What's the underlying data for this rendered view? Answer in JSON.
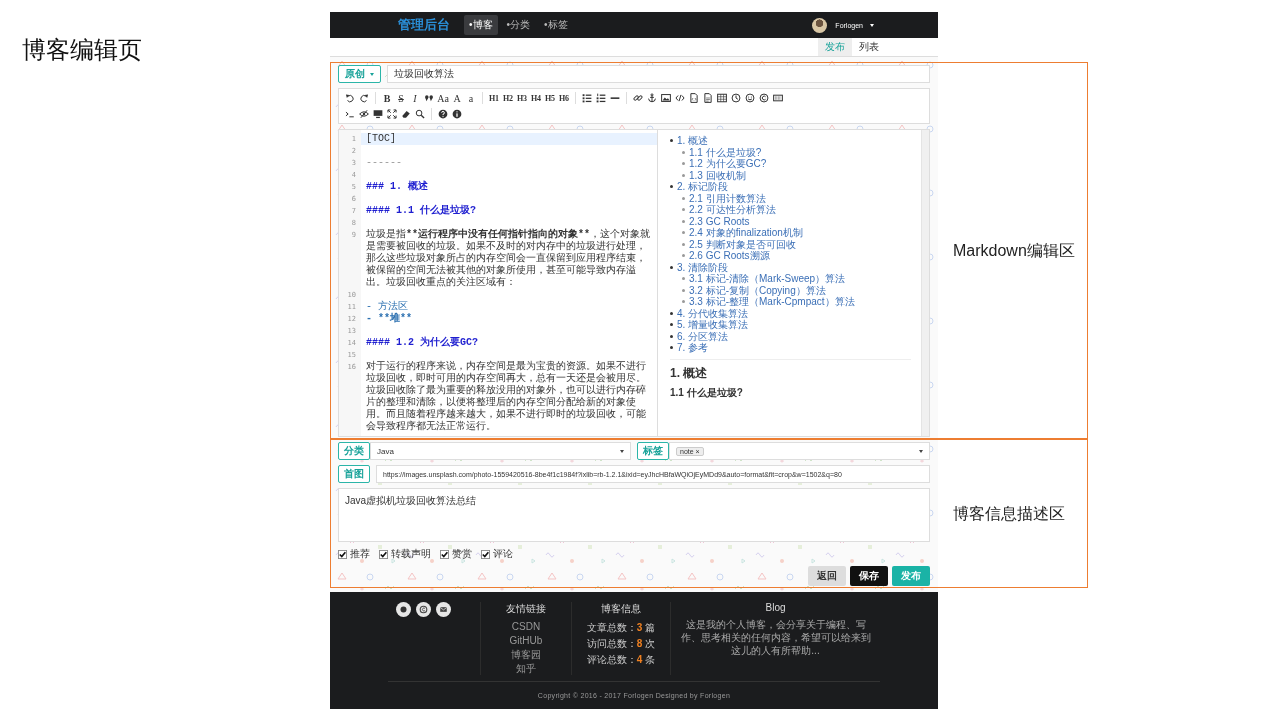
{
  "slide": {
    "title": "博客编辑页",
    "annotations": [
      {
        "label": "Markdown编辑区"
      },
      {
        "label": "博客信息描述区"
      }
    ]
  },
  "navbar": {
    "logo": "管理后台",
    "items": [
      {
        "label": "•博客",
        "selected": true
      },
      {
        "label": "•分类",
        "selected": false
      },
      {
        "label": "•标签",
        "selected": false
      }
    ],
    "user": "Forlogen"
  },
  "subnav": {
    "tabs": [
      {
        "label": "发布",
        "selected": true
      },
      {
        "label": "列表",
        "selected": false
      }
    ]
  },
  "editor": {
    "type_select": "原创",
    "title": "垃圾回收算法",
    "toolbar": [
      [
        [
          {
            "kind": "icon"
          },
          {
            "kind": "icon"
          }
        ],
        [
          {
            "kind": "bold",
            "text": "B"
          },
          {
            "kind": "strike",
            "text": "S"
          },
          {
            "kind": "italic",
            "text": "I"
          },
          {
            "kind": "icon"
          },
          {
            "kind": "text",
            "text": "Aa"
          },
          {
            "kind": "text",
            "text": "A"
          },
          {
            "kind": "text",
            "text": "a"
          }
        ],
        [
          {
            "kind": "heading",
            "text": "H1"
          },
          {
            "kind": "heading",
            "text": "H2"
          },
          {
            "kind": "heading",
            "text": "H3"
          },
          {
            "kind": "heading",
            "text": "H4"
          },
          {
            "kind": "heading",
            "text": "H5"
          },
          {
            "kind": "heading",
            "text": "H6"
          }
        ],
        [
          {
            "kind": "icon"
          },
          {
            "kind": "icon"
          },
          {
            "kind": "icon"
          }
        ],
        [
          {
            "kind": "icon"
          },
          {
            "kind": "icon"
          },
          {
            "kind": "icon"
          },
          {
            "kind": "icon"
          },
          {
            "kind": "icon"
          },
          {
            "kind": "icon"
          },
          {
            "kind": "icon"
          },
          {
            "kind": "icon"
          },
          {
            "kind": "icon"
          },
          {
            "kind": "icon"
          },
          {
            "kind": "icon"
          }
        ]
      ],
      [
        [
          {
            "kind": "icon"
          },
          {
            "kind": "icon"
          },
          {
            "kind": "icon"
          },
          {
            "kind": "icon"
          },
          {
            "kind": "icon"
          },
          {
            "kind": "icon"
          }
        ],
        [
          {
            "kind": "icon"
          },
          {
            "kind": "icon"
          }
        ]
      ]
    ],
    "lines": [
      {
        "num": "1",
        "kind": "toc",
        "active": true,
        "parts": [
          {
            "text": "[TOC]",
            "bold": false
          }
        ]
      },
      {
        "num": "2",
        "kind": "blank"
      },
      {
        "num": "3",
        "kind": "hr",
        "active": false,
        "parts": [
          {
            "text": "------",
            "bold": false
          }
        ]
      },
      {
        "num": "4",
        "kind": "blank"
      },
      {
        "num": "5",
        "kind": "heading",
        "active": false,
        "parts": [
          {
            "text": "### 1. 概述",
            "bold": true
          }
        ]
      },
      {
        "num": "6",
        "kind": "blank"
      },
      {
        "num": "7",
        "kind": "heading",
        "active": false,
        "parts": [
          {
            "text": "#### 1.1 什么是垃圾?",
            "bold": true
          }
        ]
      },
      {
        "num": "8",
        "kind": "blank"
      },
      {
        "num": "9",
        "kind": "text",
        "active": false,
        "parts": [
          {
            "text": "垃圾是指",
            "bold": false
          },
          {
            "text": "**运行程序中没有任何指针指向的对象**",
            "bold": true
          },
          {
            "text": "，这个对象就是需要被回收的垃圾。如果不及时的对内存中的垃圾进行处理，那么这些垃圾对象所占的内存空间会一直保留到应用程序结束，被保留的空间无法被其他的对象所使用，甚至可能导致内存溢出。垃圾回收重点的关注区域有：",
            "bold": false
          }
        ]
      },
      {
        "num": "10",
        "kind": "blank"
      },
      {
        "num": "11",
        "kind": "list",
        "active": false,
        "parts": [
          {
            "text": "- 方法区",
            "bold": false
          }
        ]
      },
      {
        "num": "12",
        "kind": "list",
        "active": false,
        "parts": [
          {
            "text": "- **堆**",
            "bold": true
          }
        ]
      },
      {
        "num": "13",
        "kind": "blank"
      },
      {
        "num": "14",
        "kind": "heading",
        "active": false,
        "parts": [
          {
            "text": "#### 1.2 为什么要GC?",
            "bold": true
          }
        ]
      },
      {
        "num": "15",
        "kind": "blank"
      },
      {
        "num": "16",
        "kind": "text",
        "active": false,
        "parts": [
          {
            "text": "对于运行的程序来说，内存空间是最为宝贵的资源。如果不进行垃圾回收，即时可用的内存空间再大，总有一天还是会被用尽。垃圾回收除了最为重要的释放没用的对象外，也可以进行内存碎片的整理和清除，以便将整理后的内存空间分配给新的对象使用。而且随着程序越来越大，如果不进行即时的垃圾回收，可能会导致程序都无法正常运行。",
            "bold": false
          }
        ]
      }
    ],
    "preview": {
      "toc": [
        {
          "text": "1. 概述",
          "children": [
            {
              "text": "1.1 什么是垃圾?"
            },
            {
              "text": "1.2 为什么要GC?"
            },
            {
              "text": "1.3 回收机制"
            }
          ]
        },
        {
          "text": "2. 标记阶段",
          "children": [
            {
              "text": "2.1 引用计数算法"
            },
            {
              "text": "2.2 可达性分析算法"
            },
            {
              "text": "2.3 GC Roots"
            },
            {
              "text": "2.4 对象的finalization机制"
            },
            {
              "text": "2.5 判断对象是否可回收"
            },
            {
              "text": "2.6 GC Roots溯源"
            }
          ]
        },
        {
          "text": "3. 清除阶段",
          "children": [
            {
              "text": "3.1 标记-清除（Mark-Sweep）算法"
            },
            {
              "text": "3.2 标记-复制（Copying）算法"
            },
            {
              "text": "3.3 标记-整理（Mark-Cpmpact）算法"
            }
          ]
        },
        {
          "text": "4. 分代收集算法"
        },
        {
          "text": "5. 增量收集算法"
        },
        {
          "text": "6. 分区算法"
        },
        {
          "text": "7. 参考"
        }
      ],
      "headings": [
        {
          "kind": "h1",
          "text": "1. 概述"
        },
        {
          "kind": "h2",
          "text": "1.1 什么是垃圾?"
        }
      ]
    }
  },
  "info": {
    "category": {
      "label": "分类",
      "value": "Java"
    },
    "tags": {
      "label": "标签",
      "items": [
        {
          "text": "note",
          "remove": "×"
        }
      ]
    },
    "cover": {
      "label": "首图",
      "value": "https://images.unsplash.com/photo-1559420516-8be4f1c1984f?ixlib=rb-1.2.1&ixid=eyJhcHBfaWQiOjEyMDd9&auto=format&fit=crop&w=1502&q=80"
    },
    "summary": "Java虚拟机垃圾回收算法总结",
    "options": [
      {
        "label": "推荐",
        "checked": true
      },
      {
        "label": "转载声明",
        "checked": true
      },
      {
        "label": "赞赏",
        "checked": true
      },
      {
        "label": "评论",
        "checked": true
      }
    ],
    "buttons": [
      {
        "label": "返回",
        "kind": "default"
      },
      {
        "label": "保存",
        "kind": "dark"
      },
      {
        "label": "发布",
        "kind": "primary"
      }
    ]
  },
  "footer": {
    "links_title": "友情链接",
    "links": [
      "CSDN",
      "GitHUb",
      "博客园",
      "知乎"
    ],
    "stats_title": "博客信息",
    "stats": [
      {
        "label": "文章总数：",
        "value": "3",
        "unit": "篇"
      },
      {
        "label": "访问总数：",
        "value": "8",
        "unit": "次"
      },
      {
        "label": "评论总数：",
        "value": "4",
        "unit": "条"
      }
    ],
    "blog_title": "Blog",
    "blog_text": "这是我的个人博客，会分享关于编程、写作、思考相关的任何内容，希望可以给来到这儿的人有所帮助...",
    "copyright": "Copyright © 2016 - 2017 Forlogen Designed by Forlogen"
  }
}
